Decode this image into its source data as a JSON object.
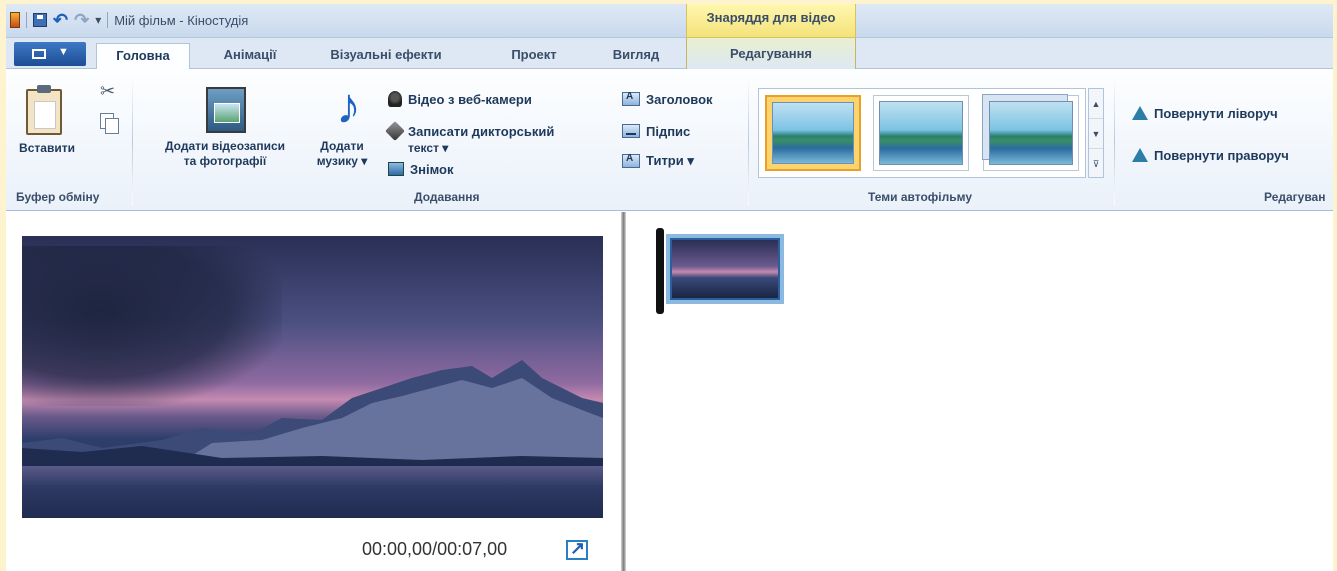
{
  "window": {
    "title": "Мій фільм - Кіностудія",
    "context_tab_header": "Знаряддя для відео"
  },
  "tabs": [
    {
      "label": "Головна",
      "active": true
    },
    {
      "label": "Анімації"
    },
    {
      "label": "Візуальні ефекти"
    },
    {
      "label": "Проект"
    },
    {
      "label": "Вигляд"
    },
    {
      "label": "Редагування",
      "context": true
    }
  ],
  "ribbon": {
    "clipboard": {
      "paste_label": "Вставити",
      "group_label": "Буфер обміну"
    },
    "add": {
      "add_media_label_1": "Додати відеозаписи",
      "add_media_label_2": "та фотографії",
      "add_music_label_1": "Додати",
      "add_music_label_2": "музику ▾",
      "webcam_label": "Відео з веб-камери",
      "narration_label_1": "Записати дикторський",
      "narration_label_2": "текст ▾",
      "snapshot_label": "Знімок",
      "title_label": "Заголовок",
      "caption_label": "Підпис",
      "credits_label": "Титри ▾",
      "group_label": "Додавання"
    },
    "themes": {
      "group_label": "Теми автофільму",
      "items": [
        "theme-default",
        "theme-contemporary",
        "theme-cinematic"
      ],
      "selected_index": 0
    },
    "editing": {
      "rotate_left_label": "Повернути ліворуч",
      "rotate_right_label": "Повернути праворуч",
      "group_label": "Редагуван"
    }
  },
  "preview": {
    "timecode": "00:00,00/00:07,00"
  },
  "storyboard": {
    "clips": [
      {
        "name": "clip-1"
      }
    ]
  }
}
